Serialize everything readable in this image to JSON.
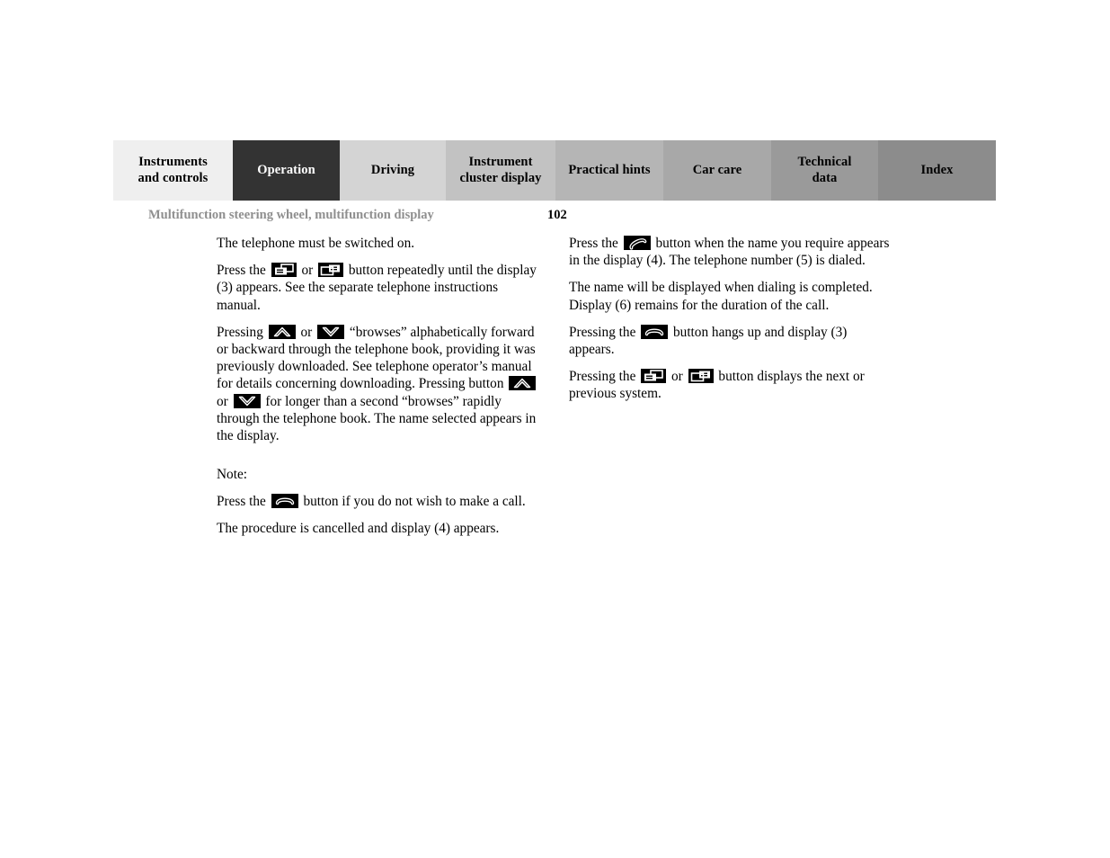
{
  "tabs": [
    {
      "label": "Instruments and controls",
      "lines": [
        "Instruments",
        "and controls"
      ],
      "state": "inactive",
      "bg": "#efefef",
      "fg": "#000000"
    },
    {
      "label": "Operation",
      "lines": [
        "Operation"
      ],
      "state": "active",
      "bg": "#333333",
      "fg": "#ffffff"
    },
    {
      "label": "Driving",
      "lines": [
        "Driving"
      ],
      "state": "inactive",
      "bg": "#d4d4d4",
      "fg": "#000000"
    },
    {
      "label": "Instrument cluster display",
      "lines": [
        "Instrument",
        "cluster display"
      ],
      "state": "inactive",
      "bg": "#c2c2c2",
      "fg": "#000000"
    },
    {
      "label": "Practical hints",
      "lines": [
        "Practical hints"
      ],
      "state": "inactive",
      "bg": "#b5b5b5",
      "fg": "#000000"
    },
    {
      "label": "Car care",
      "lines": [
        "Car care"
      ],
      "state": "inactive",
      "bg": "#a8a8a8",
      "fg": "#000000"
    },
    {
      "label": "Technical data",
      "lines": [
        "Technical",
        "data"
      ],
      "state": "inactive",
      "bg": "#9a9a9a",
      "fg": "#000000"
    },
    {
      "label": "Index",
      "lines": [
        "Index"
      ],
      "state": "inactive",
      "bg": "#8c8c8c",
      "fg": "#000000"
    }
  ],
  "header": {
    "section_title": "Multifunction steering wheel, multifunction display",
    "page_number": "102",
    "title_color": "#8f8f8f"
  },
  "left_column": {
    "p1": "The telephone must be switched on.",
    "p2_a": "Press the",
    "p2_b": "or",
    "p2_c": "button repeatedly until the display (3) appears. See the separate telephone instructions manual.",
    "p3_a": "Pressing",
    "p3_b": "or",
    "p3_c": "“browses” alphabetically forward or backward through the telephone book, providing it was previously downloaded. See telephone operator’s manual for details concerning downloading. Pressing button",
    "p3_d": "or",
    "p3_e": "for longer than a second “browses” rapidly through the telephone book. The name selected appears in the display.",
    "note_label": "Note:",
    "p4_a": "Press the",
    "p4_b": "button if you do not wish to make a call.",
    "p5": "The procedure is cancelled and display (4) appears."
  },
  "right_column": {
    "p1_a": "Press the",
    "p1_b": "button when the name you require appears in the display (4). The telephone number (5) is dialed.",
    "p2": "The name will be displayed when dialing is completed. Display (6) remains for the duration of the call.",
    "p3_a": "Pressing the",
    "p3_b": "button hangs up and display (3) appears.",
    "p4_a": "Pressing the",
    "p4_b": "or",
    "p4_c": "button displays the next or previous system."
  },
  "icons": {
    "next_system": "next-system-button-icon",
    "prev_system": "previous-system-button-icon",
    "browse_up": "browse-up-button-icon",
    "browse_down": "browse-down-button-icon",
    "hang_up": "hang-up-phone-button-icon",
    "call": "call-phone-button-icon"
  }
}
